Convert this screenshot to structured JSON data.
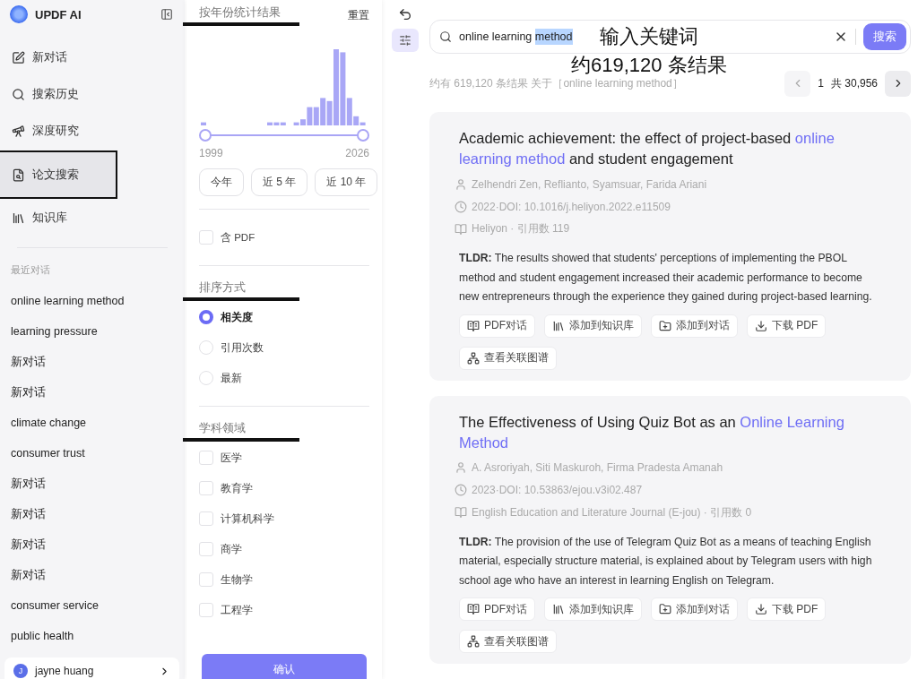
{
  "sidebar": {
    "app_name": "UPDF AI",
    "nav": [
      {
        "label": "新对话",
        "selected": false,
        "callout": false
      },
      {
        "label": "搜索历史",
        "selected": false,
        "callout": false
      },
      {
        "label": "深度研究",
        "selected": false,
        "callout": false
      },
      {
        "label": "论文搜索",
        "selected": true,
        "callout": true
      },
      {
        "label": "知识库",
        "selected": false,
        "callout": false
      }
    ],
    "recent_title": "最近对话",
    "recent": [
      "online learning method",
      "learning pressure",
      "新对话",
      "新对话",
      "climate change",
      "consumer trust",
      "新对话",
      "新对话",
      "新对话",
      "新对话",
      "consumer service",
      "public health"
    ],
    "user": {
      "name": "jayne huang",
      "initial": "J"
    }
  },
  "filters": {
    "year_title": "按年份统计结果",
    "year_callout": true,
    "reset": "重置",
    "year_range": {
      "level": 1,
      "start": "1999",
      "end": "2026"
    },
    "presets": [
      "今年",
      "近 5 年",
      "近 10 年"
    ],
    "pdf": {
      "label": "含 PDF",
      "checked": false
    },
    "sort_title": "排序方式",
    "sort_callout": true,
    "sort": [
      {
        "label": "相关度",
        "selected": true
      },
      {
        "label": "引用次数",
        "selected": false
      },
      {
        "label": "最新",
        "selected": false
      }
    ],
    "field_title": "学科领域",
    "field_callout": true,
    "fields": [
      {
        "label": "医学",
        "checked": false
      },
      {
        "label": "教育学",
        "checked": false
      },
      {
        "label": "计算机科学",
        "checked": false
      },
      {
        "label": "商学",
        "checked": false
      },
      {
        "label": "生物学",
        "checked": false
      },
      {
        "label": "工程学",
        "checked": false
      }
    ],
    "confirm": "确认"
  },
  "search": {
    "value": [
      {
        "text": "online learning ",
        "selected": false
      },
      {
        "text": "method",
        "selected": true
      }
    ],
    "button": "搜索"
  },
  "callouts": [
    "输入关键词",
    "约619,120 条结果"
  ],
  "summary": "约有 619,120 条结果 关于［online learning method］",
  "pagination": {
    "page": "1",
    "total": "共 30,956"
  },
  "results": [
    {
      "title": [
        {
          "text": "Academic achievement: the effect of project-based ",
          "highlight": false
        },
        {
          "text": "online learning method",
          "highlight": true
        },
        {
          "text": " and student engagement",
          "highlight": false
        }
      ],
      "authors": "Zelhendri Zen, Reflianto, Syamsuar, Farida Ariani",
      "doi": "2022·DOI: 10.1016/j.heliyon.2022.e11509",
      "source": "Heliyon · 引用数 119",
      "tldr": "**TLDR:** The results showed that students' perceptions of implementing the PBOL method and student engagement increased their academic performance to become new entrepreneurs through the experience they gained during project-based learning.",
      "actions": [
        "PDF对话",
        "添加到知识库",
        "添加到对话",
        "下载 PDF",
        "查看关联图谱"
      ]
    },
    {
      "title": [
        {
          "text": "The Effectiveness of Using Quiz Bot as an ",
          "highlight": false
        },
        {
          "text": "Online Learning Method",
          "highlight": true
        }
      ],
      "authors": "A. Asroriyah, Siti Maskuroh, Firma Pradesta Amanah",
      "doi": "2023·DOI: 10.53863/ejou.v3i02.487",
      "source": "English Education and Literature Journal (E-jou) · 引用数 0",
      "tldr": "**TLDR:** The provision of the use of Telegram Quiz Bot as a means of teaching English material, especially structure material, is explained about by Telegram users with high school age who have an interest in learning English on Telegram.",
      "actions": [
        "PDF对话",
        "添加到知识库",
        "添加到对话",
        "下载 PDF",
        "查看关联图谱"
      ]
    }
  ]
}
